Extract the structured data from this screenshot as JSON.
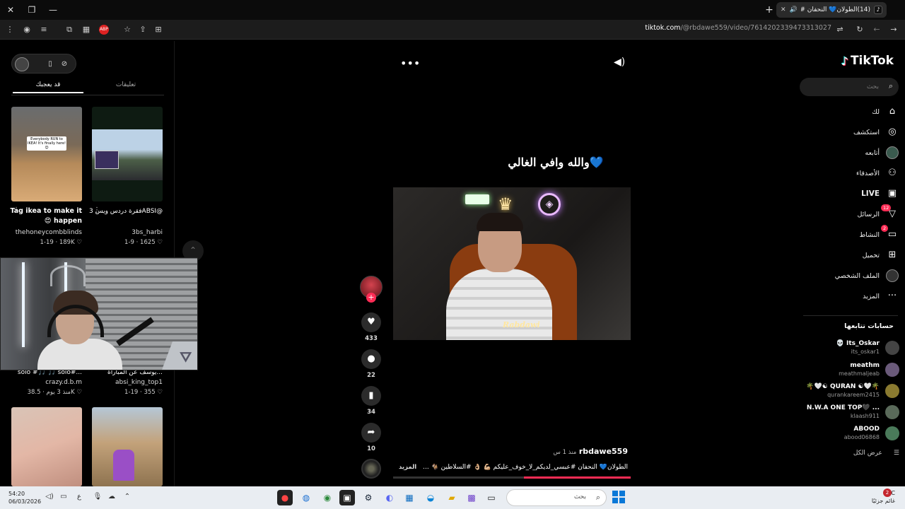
{
  "browser": {
    "tab_count_title": "(14)الطولان💙 النحفان #عبس...",
    "tab_favicon": "tiktok-icon",
    "url_host": "tiktok.com",
    "url_path": "/@rbdawe559/video/7614202339473313027",
    "abp_label": "ABP"
  },
  "sidebar": {
    "logo": "TikTok",
    "search_placeholder": "بحث",
    "items": [
      {
        "label": "لك",
        "icon": "home-icon"
      },
      {
        "label": "استكشف",
        "icon": "compass-icon"
      },
      {
        "label": "أتابعه",
        "icon": "avatar-icon"
      },
      {
        "label": "الأصدقاء",
        "icon": "friends-icon"
      },
      {
        "label": "LIVE",
        "icon": "live-icon"
      },
      {
        "label": "الرسائل",
        "icon": "messages-icon",
        "badge": "12"
      },
      {
        "label": "النشاط",
        "icon": "activity-icon",
        "badge": "2"
      },
      {
        "label": "تحميل",
        "icon": "upload-icon"
      },
      {
        "label": "الملف الشخصي",
        "icon": "profile-icon"
      },
      {
        "label": "المزيد",
        "icon": "more-icon"
      }
    ],
    "following_header": "حسابات تتابعها",
    "accounts": [
      {
        "name": "💀 Its_Oskar",
        "handle": "its_oskar1",
        "color": "#444444"
      },
      {
        "name": "meathm",
        "handle": "meathmaljeab",
        "color": "#6a5a7a"
      },
      {
        "name": "🌴🤍☯ QURAN ☯🤍🌴",
        "handle": "qurankareem2415",
        "color": "#8a7a30"
      },
      {
        "name": "N.W.A ONE TOP🖤 ...",
        "handle": "klaash911",
        "color": "#5a6a5a"
      },
      {
        "name": "ABOOD",
        "handle": "abood06868",
        "color": "#4a7a5a"
      }
    ],
    "see_all": "عرض الكل"
  },
  "video": {
    "caption_overlay": "والله وافي الغالي💙",
    "watermark_name": "Rabdawi",
    "author": "rbdawe559",
    "posted": "منذ 1 س",
    "description": "الطولان💙 النحفان #عبسي_لديكم_لا_خوف_عليكم 💪🏼 👌🏼 #السلاطين 🐐 ...",
    "more": "المزيد",
    "likes": "433",
    "comments": "22",
    "saves": "34",
    "shares": "10",
    "progress": 0.45
  },
  "left_panel": {
    "tabs": [
      "تعليقات",
      "قد يعجبك"
    ],
    "active_tab": 1,
    "cards": [
      {
        "title": "Tag ikea to make it 😍 happen",
        "user": "thehoneycombblinds",
        "stats": "1-19 · 189K ♡",
        "banner": "Everybody RUN to IKEA! It's finally here!😊"
      },
      {
        "title": "فقرة دردس ويس 3ABSI@...",
        "user": "3bs_harbi",
        "stats": "1-9 · 1625 ♡"
      },
      {
        "title": "solo #🎵 🎵 solo#...",
        "user": "crazy.d.b.m",
        "stats": "منذ 3 يوم · 38.5K ♡"
      },
      {
        "title": "يوسف عن المباراة...",
        "user": "absi_king_top1",
        "stats": "1-19 · 355 ♡"
      }
    ]
  },
  "taskbar": {
    "time": "54:20",
    "date": "06/03/2026",
    "lang": "ع",
    "search_label": "بحث",
    "weather_temp": "9°C",
    "weather_text": "غائم جزئيًا",
    "notif_count": "2"
  }
}
